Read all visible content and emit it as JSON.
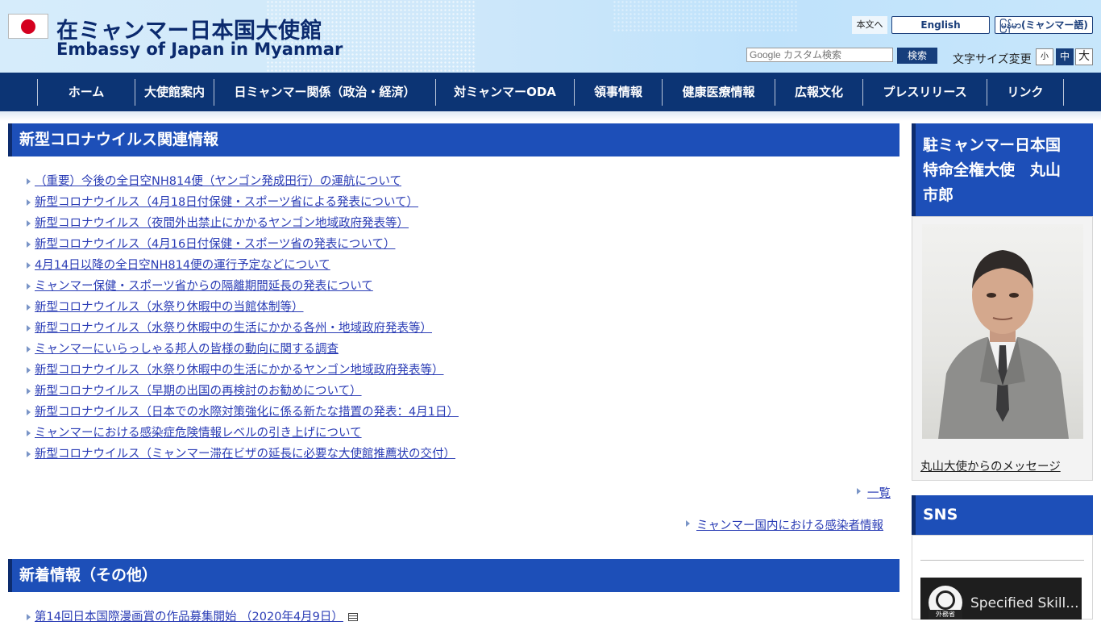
{
  "header": {
    "title_ja": "在ミャンマー日本国大使館",
    "title_en": "Embassy of Japan in Myanmar",
    "flag_icon": "japan-flag-icon"
  },
  "utility": {
    "skip_link": "本文へ",
    "lang_english": "English",
    "lang_myanmar": "မြန်မာ(ミャンマー語)",
    "search_placeholder": "Google カスタム検索",
    "search_button": "検索",
    "font_size_label": "文字サイズ変更",
    "font_small": "小",
    "font_medium": "中",
    "font_large": "大"
  },
  "nav": {
    "items": [
      {
        "label": "ホーム"
      },
      {
        "label": "大使館案内"
      },
      {
        "label": "日ミャンマー関係（政治・経済）"
      },
      {
        "label": "対ミャンマーODA"
      },
      {
        "label": "領事情報"
      },
      {
        "label": "健康医療情報"
      },
      {
        "label": "広報文化"
      },
      {
        "label": "プレスリリース"
      },
      {
        "label": "リンク"
      }
    ]
  },
  "covid": {
    "heading": "新型コロナウイルス関連情報",
    "items": [
      "（重要）今後の全日空NH814便（ヤンゴン発成田行）の運航について",
      "新型コロナウイルス（4月18日付保健・スポーツ省による発表について）",
      "新型コロナウイルス（夜間外出禁止にかかるヤンゴン地域政府発表等）",
      "新型コロナウイルス（4月16日付保健・スポーツ省の発表について）",
      "4月14日以降の全日空NH814便の運行予定などについて",
      "ミャンマー保健・スポーツ省からの隔離期間延長の発表について",
      "新型コロナウイルス（水祭り休暇中の当館体制等）",
      "新型コロナウイルス（水祭り休暇中の生活にかかる各州・地域政府発表等）",
      "ミャンマーにいらっしゃる邦人の皆様の動向に関する調査",
      "新型コロナウイルス（水祭り休暇中の生活にかかるヤンゴン地域政府発表等）",
      "新型コロナウイルス（早期の出国の再検討のお勧めについて）",
      "新型コロナウイルス（日本での水際対策強化に係る新たな措置の発表：4月1日）",
      "ミャンマーにおける感染症危険情報レベルの引き上げについて",
      "新型コロナウイルス（ミャンマー滞在ビザの延長に必要な大使館推薦状の交付）"
    ],
    "list_link": "一覧",
    "infection_link": "ミャンマー国内における感染者情報"
  },
  "news_other": {
    "heading": "新着情報（その他）",
    "first_item": "第14回日本国際漫画賞の作品募集開始 （2020年4月9日）"
  },
  "sidebar": {
    "ambassador_heading_lines": [
      "駐ミャンマー日本国",
      "特命全権大使　丸山",
      "市郎"
    ],
    "ambassador_link": "丸山大使からのメッセージ",
    "sns_heading": "SNS",
    "video_title": "Specified Skill...",
    "video_logo_text": "外務省"
  }
}
